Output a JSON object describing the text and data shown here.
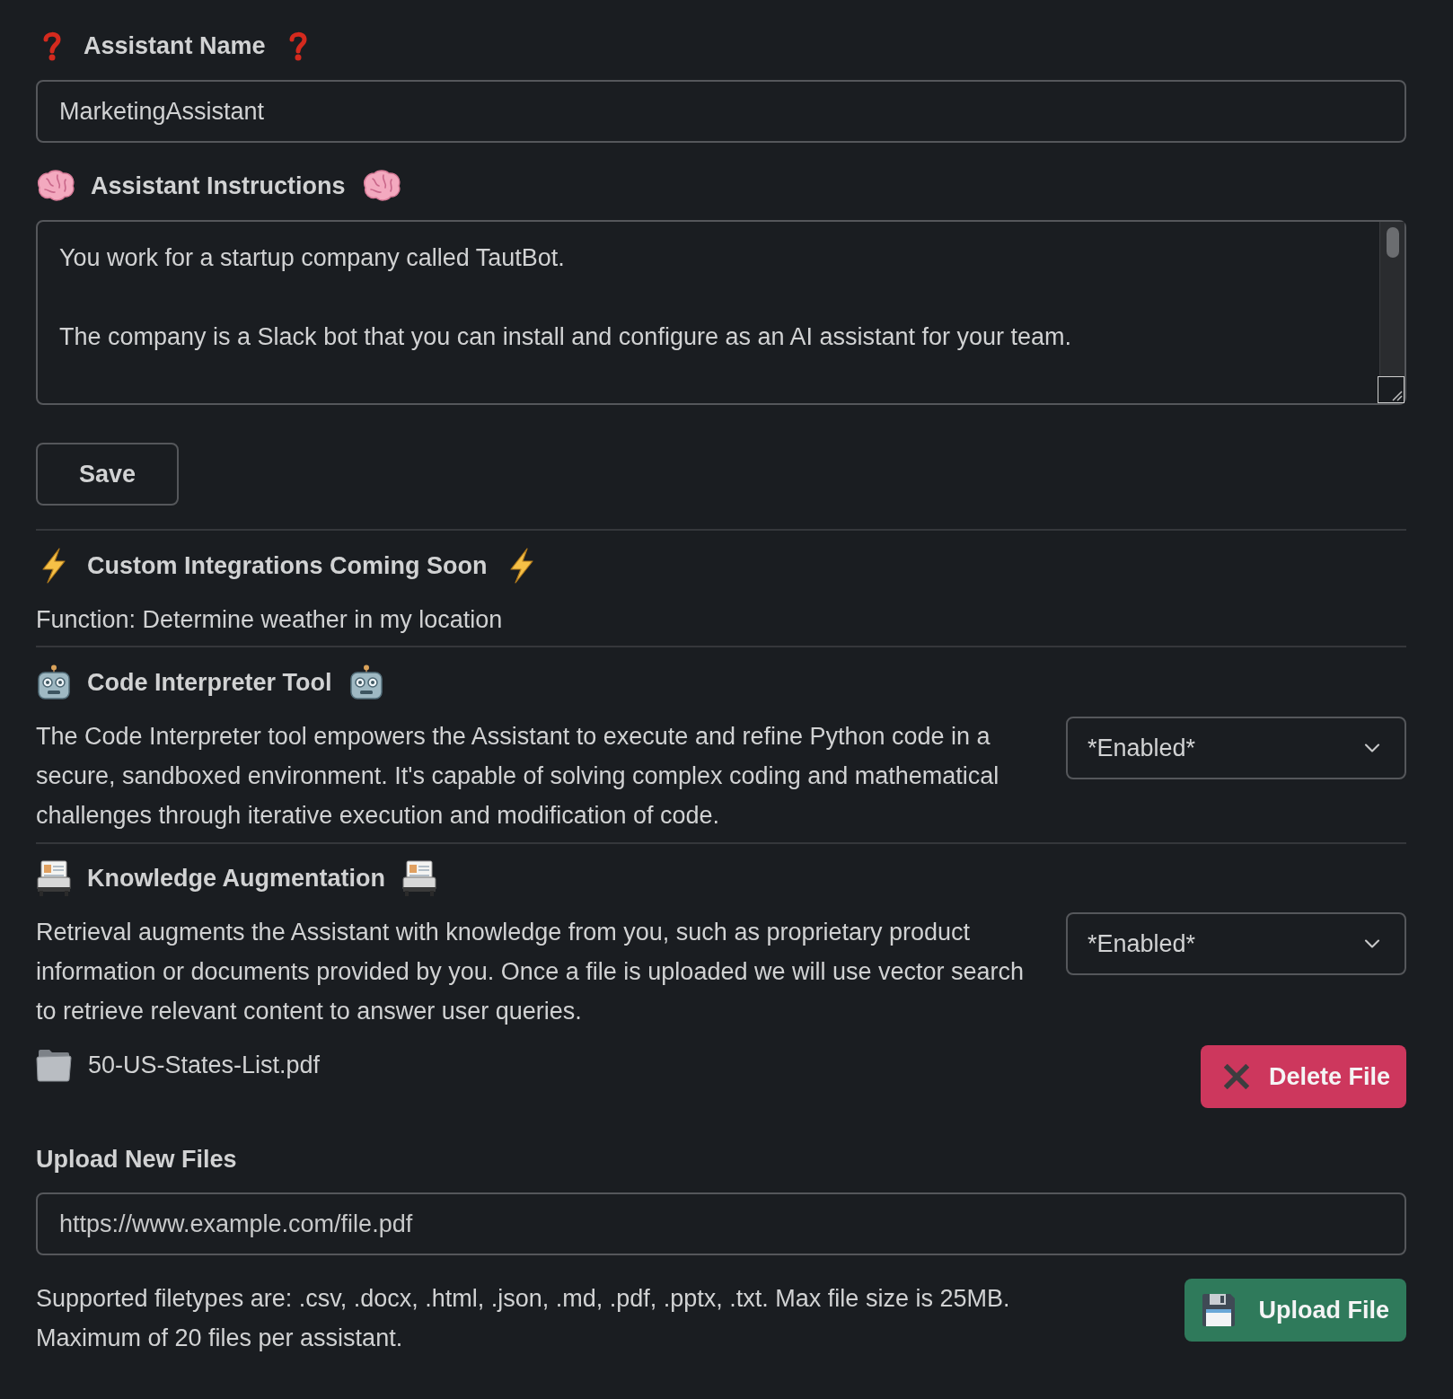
{
  "assistant_name": {
    "label": "Assistant Name",
    "value": "MarketingAssistant"
  },
  "assistant_instructions": {
    "label": "Assistant Instructions",
    "value": "You work for a startup company called TautBot.\n\nThe company is a Slack bot that you can install and configure as an AI assistant for your team."
  },
  "save_button": "Save",
  "custom_integrations": {
    "title": "Custom Integrations Coming Soon",
    "functions": [
      "Function: Determine weather in my location"
    ]
  },
  "code_interpreter": {
    "title": "Code Interpreter Tool",
    "description": "The Code Interpreter tool empowers the Assistant to execute and refine Python code in a secure, sandboxed environment. It's capable of solving complex coding and mathematical challenges through iterative execution and modification of code.",
    "select": "*Enabled*"
  },
  "knowledge_augmentation": {
    "title": "Knowledge Augmentation",
    "description": "Retrieval augments the Assistant with knowledge from you, such as proprietary product information or documents provided by you. Once a file is uploaded we will use vector search to retrieve relevant content to answer user queries.",
    "select": "*Enabled*",
    "files": [
      {
        "name": "50-US-States-List.pdf",
        "delete_button": "Delete File"
      }
    ]
  },
  "upload": {
    "label": "Upload New Files",
    "placeholder": "https://www.example.com/file.pdf",
    "note": "Supported filetypes are: .csv, .docx, .html, .json, .md, .pdf, .pptx, .txt. Max file size is 25MB.\nMaximum of 20 files per assistant.",
    "button": "Upload File"
  }
}
